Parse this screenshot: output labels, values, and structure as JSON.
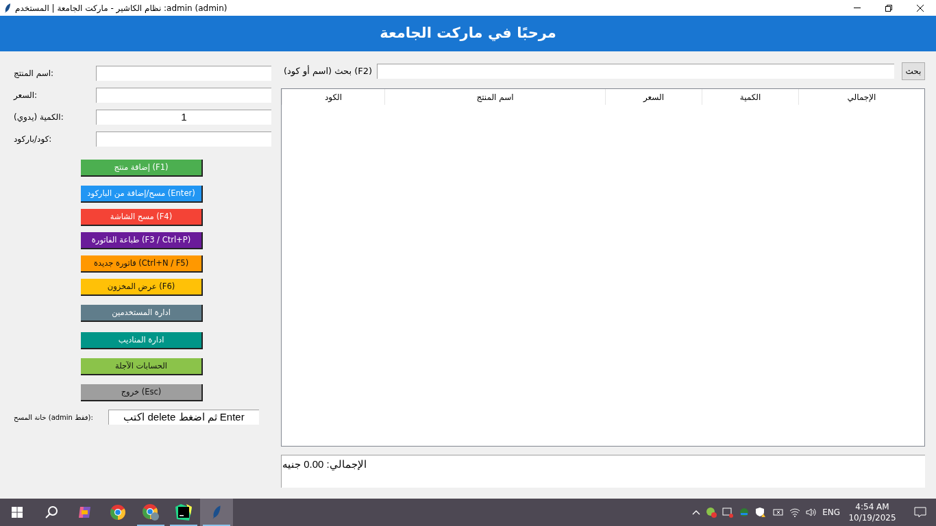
{
  "window": {
    "title": "نظام الكاشير - ماركت الجامعة | المستخدم :admin (admin)"
  },
  "header": {
    "title": "مرحبًا في ماركت الجامعة"
  },
  "fields": [
    {
      "label": "اسم المنتج:"
    },
    {
      "label": "السعر:"
    },
    {
      "label": "الكمية (يدوي):",
      "value": "1"
    },
    {
      "label": "كود/باركود:"
    }
  ],
  "buttons": [
    {
      "label": "إضافة منتج (F1)",
      "color": "#4caf50"
    },
    {
      "label": "مسح/إضافة من الباركود (Enter)",
      "color": "#2196f3"
    },
    {
      "label": "مسح الشاشة (F4)",
      "color": "#f44336"
    },
    {
      "label": "طباعة الفاتورة (F3 / Ctrl+P)",
      "color": "#6a1b9a"
    },
    {
      "label": "فاتورة جديدة (Ctrl+N / F5)",
      "color": "#ff9800"
    },
    {
      "label": "عرض المخزون (F6)",
      "color": "#ffc107"
    },
    {
      "label": "ادارة المستخدمين",
      "color": "#607d8b"
    },
    {
      "label": "ادارة المناديب",
      "color": "#009688"
    },
    {
      "label": "الحسابات الآجلة",
      "color": "#8bc34a"
    },
    {
      "label": "خروج (Esc)",
      "color": "#9e9e9e"
    }
  ],
  "delete_field": {
    "label": "خانة المسح (admin فقط):",
    "value": "اكتب delete ثم اضغط Enter"
  },
  "search": {
    "label": "بحث (اسم أو كود) (F2)",
    "button": "بحث"
  },
  "table": {
    "columns": [
      "الإجمالي",
      "الكمية",
      "السعر",
      "اسم المنتج",
      "الكود"
    ]
  },
  "total": {
    "text": "الإجمالي: 0.00 جنيه"
  },
  "taskbar": {
    "apps": [
      {
        "kind": "copilot",
        "running": false
      },
      {
        "kind": "chrome",
        "running": false
      },
      {
        "kind": "chrome-profile",
        "running": true
      },
      {
        "kind": "pycharm",
        "running": true
      },
      {
        "kind": "feather",
        "running": true
      }
    ],
    "language": "ENG",
    "time": "4:54 AM",
    "date": "10/19/2025"
  }
}
